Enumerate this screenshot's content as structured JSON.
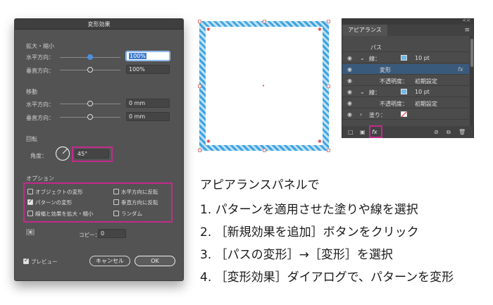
{
  "dialog": {
    "title": "変形効果",
    "scale": {
      "section": "拡大・縮小",
      "horizontal_label": "水平方向：",
      "horizontal_value": "100%",
      "vertical_label": "垂直方向：",
      "vertical_value": "100%"
    },
    "move": {
      "section": "移動",
      "horizontal_label": "水平方向：",
      "horizontal_value": "0 mm",
      "vertical_label": "垂直方向：",
      "vertical_value": "0 mm"
    },
    "rotate": {
      "section": "回転",
      "angle_label": "角度：",
      "angle_value": "45°"
    },
    "options": {
      "section": "オプション",
      "items": [
        {
          "label": "オブジェクトの変形",
          "checked": false
        },
        {
          "label": "パターンの変形",
          "checked": true
        },
        {
          "label": "線幅と効果を拡大・縮小",
          "checked": false
        },
        {
          "label": "水平方向に反転",
          "checked": false
        },
        {
          "label": "垂直方向に反転",
          "checked": false
        },
        {
          "label": "ランダム",
          "checked": false
        }
      ]
    },
    "copies_label": "コピー：",
    "copies_value": "0",
    "preview_label": "プレビュー",
    "preview_checked": true,
    "cancel_label": "キャンセル",
    "ok_label": "OK"
  },
  "appearance_panel": {
    "tab": "アピアランス",
    "collapse": "<<",
    "menu": "≡",
    "header": "パス",
    "rows": [
      {
        "kind": "stroke",
        "label": "線：",
        "value": "10 pt"
      },
      {
        "kind": "effect",
        "label": "変形",
        "fx": "fx"
      },
      {
        "kind": "opacity",
        "label": "不透明度：",
        "value": "初期設定"
      },
      {
        "kind": "stroke",
        "label": "線：",
        "value": "10 pt"
      },
      {
        "kind": "opacity",
        "label": "不透明度：",
        "value": "初期設定"
      },
      {
        "kind": "fill",
        "label": "塗り："
      }
    ],
    "fx_button": "fx"
  },
  "instructions": {
    "heading": "アピアランスパネルで",
    "steps": [
      "1. パターンを適用させた塗りや線を選択",
      "2. ［新規効果を追加］ボタンをクリック",
      "3. ［パスの変形］→［変形］を選択",
      "4. ［変形効果］ダイアログで、パターンを変形"
    ]
  },
  "colors": {
    "accent_pink": "#c42a8c",
    "stripe_blue": "#3fa3e0",
    "dialog_bg": "#535353",
    "panel_bg": "#4b4b4b",
    "selected_row": "#3a5a7c"
  }
}
